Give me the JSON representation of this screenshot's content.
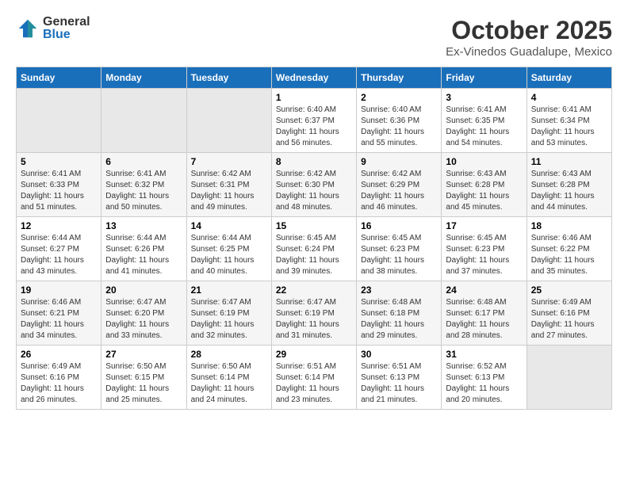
{
  "header": {
    "logo_general": "General",
    "logo_blue": "Blue",
    "month": "October 2025",
    "location": "Ex-Vinedos Guadalupe, Mexico"
  },
  "weekdays": [
    "Sunday",
    "Monday",
    "Tuesday",
    "Wednesday",
    "Thursday",
    "Friday",
    "Saturday"
  ],
  "weeks": [
    [
      {
        "day": "",
        "info": ""
      },
      {
        "day": "",
        "info": ""
      },
      {
        "day": "",
        "info": ""
      },
      {
        "day": "1",
        "info": "Sunrise: 6:40 AM\nSunset: 6:37 PM\nDaylight: 11 hours\nand 56 minutes."
      },
      {
        "day": "2",
        "info": "Sunrise: 6:40 AM\nSunset: 6:36 PM\nDaylight: 11 hours\nand 55 minutes."
      },
      {
        "day": "3",
        "info": "Sunrise: 6:41 AM\nSunset: 6:35 PM\nDaylight: 11 hours\nand 54 minutes."
      },
      {
        "day": "4",
        "info": "Sunrise: 6:41 AM\nSunset: 6:34 PM\nDaylight: 11 hours\nand 53 minutes."
      }
    ],
    [
      {
        "day": "5",
        "info": "Sunrise: 6:41 AM\nSunset: 6:33 PM\nDaylight: 11 hours\nand 51 minutes."
      },
      {
        "day": "6",
        "info": "Sunrise: 6:41 AM\nSunset: 6:32 PM\nDaylight: 11 hours\nand 50 minutes."
      },
      {
        "day": "7",
        "info": "Sunrise: 6:42 AM\nSunset: 6:31 PM\nDaylight: 11 hours\nand 49 minutes."
      },
      {
        "day": "8",
        "info": "Sunrise: 6:42 AM\nSunset: 6:30 PM\nDaylight: 11 hours\nand 48 minutes."
      },
      {
        "day": "9",
        "info": "Sunrise: 6:42 AM\nSunset: 6:29 PM\nDaylight: 11 hours\nand 46 minutes."
      },
      {
        "day": "10",
        "info": "Sunrise: 6:43 AM\nSunset: 6:28 PM\nDaylight: 11 hours\nand 45 minutes."
      },
      {
        "day": "11",
        "info": "Sunrise: 6:43 AM\nSunset: 6:28 PM\nDaylight: 11 hours\nand 44 minutes."
      }
    ],
    [
      {
        "day": "12",
        "info": "Sunrise: 6:44 AM\nSunset: 6:27 PM\nDaylight: 11 hours\nand 43 minutes."
      },
      {
        "day": "13",
        "info": "Sunrise: 6:44 AM\nSunset: 6:26 PM\nDaylight: 11 hours\nand 41 minutes."
      },
      {
        "day": "14",
        "info": "Sunrise: 6:44 AM\nSunset: 6:25 PM\nDaylight: 11 hours\nand 40 minutes."
      },
      {
        "day": "15",
        "info": "Sunrise: 6:45 AM\nSunset: 6:24 PM\nDaylight: 11 hours\nand 39 minutes."
      },
      {
        "day": "16",
        "info": "Sunrise: 6:45 AM\nSunset: 6:23 PM\nDaylight: 11 hours\nand 38 minutes."
      },
      {
        "day": "17",
        "info": "Sunrise: 6:45 AM\nSunset: 6:23 PM\nDaylight: 11 hours\nand 37 minutes."
      },
      {
        "day": "18",
        "info": "Sunrise: 6:46 AM\nSunset: 6:22 PM\nDaylight: 11 hours\nand 35 minutes."
      }
    ],
    [
      {
        "day": "19",
        "info": "Sunrise: 6:46 AM\nSunset: 6:21 PM\nDaylight: 11 hours\nand 34 minutes."
      },
      {
        "day": "20",
        "info": "Sunrise: 6:47 AM\nSunset: 6:20 PM\nDaylight: 11 hours\nand 33 minutes."
      },
      {
        "day": "21",
        "info": "Sunrise: 6:47 AM\nSunset: 6:19 PM\nDaylight: 11 hours\nand 32 minutes."
      },
      {
        "day": "22",
        "info": "Sunrise: 6:47 AM\nSunset: 6:19 PM\nDaylight: 11 hours\nand 31 minutes."
      },
      {
        "day": "23",
        "info": "Sunrise: 6:48 AM\nSunset: 6:18 PM\nDaylight: 11 hours\nand 29 minutes."
      },
      {
        "day": "24",
        "info": "Sunrise: 6:48 AM\nSunset: 6:17 PM\nDaylight: 11 hours\nand 28 minutes."
      },
      {
        "day": "25",
        "info": "Sunrise: 6:49 AM\nSunset: 6:16 PM\nDaylight: 11 hours\nand 27 minutes."
      }
    ],
    [
      {
        "day": "26",
        "info": "Sunrise: 6:49 AM\nSunset: 6:16 PM\nDaylight: 11 hours\nand 26 minutes."
      },
      {
        "day": "27",
        "info": "Sunrise: 6:50 AM\nSunset: 6:15 PM\nDaylight: 11 hours\nand 25 minutes."
      },
      {
        "day": "28",
        "info": "Sunrise: 6:50 AM\nSunset: 6:14 PM\nDaylight: 11 hours\nand 24 minutes."
      },
      {
        "day": "29",
        "info": "Sunrise: 6:51 AM\nSunset: 6:14 PM\nDaylight: 11 hours\nand 23 minutes."
      },
      {
        "day": "30",
        "info": "Sunrise: 6:51 AM\nSunset: 6:13 PM\nDaylight: 11 hours\nand 21 minutes."
      },
      {
        "day": "31",
        "info": "Sunrise: 6:52 AM\nSunset: 6:13 PM\nDaylight: 11 hours\nand 20 minutes."
      },
      {
        "day": "",
        "info": ""
      }
    ]
  ]
}
